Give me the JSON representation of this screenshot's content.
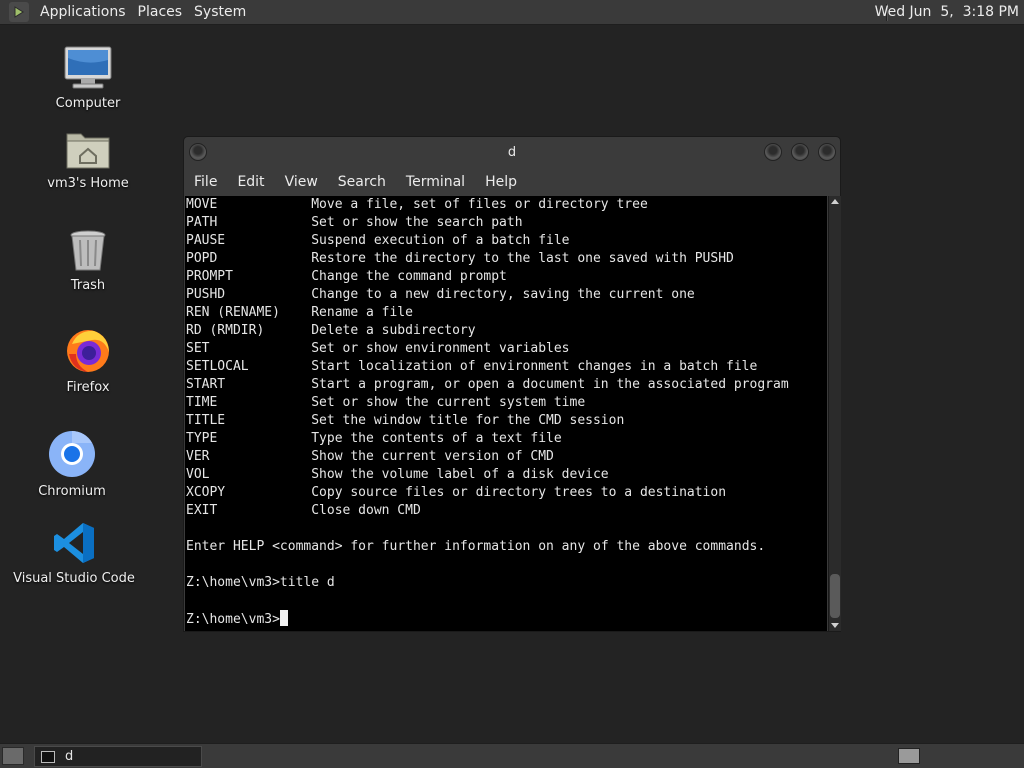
{
  "top_panel": {
    "menus": [
      "Applications",
      "Places",
      "System"
    ],
    "clock": "Wed Jun  5,  3:18 PM"
  },
  "desktop_icons": [
    {
      "label": "Computer",
      "icon": "computer-icon"
    },
    {
      "label": "vm3's Home",
      "icon": "home-folder-icon"
    },
    {
      "label": "Trash",
      "icon": "trash-icon"
    },
    {
      "label": "Firefox",
      "icon": "firefox-icon"
    },
    {
      "label": "Chromium",
      "icon": "chromium-icon"
    },
    {
      "label": "Visual Studio Code",
      "icon": "vscode-icon"
    }
  ],
  "terminal": {
    "title": "d",
    "menus": [
      "File",
      "Edit",
      "View",
      "Search",
      "Terminal",
      "Help"
    ],
    "commands": [
      {
        "cmd": "MOVE",
        "desc": "Move a file, set of files or directory tree"
      },
      {
        "cmd": "PATH",
        "desc": "Set or show the search path"
      },
      {
        "cmd": "PAUSE",
        "desc": "Suspend execution of a batch file"
      },
      {
        "cmd": "POPD",
        "desc": "Restore the directory to the last one saved with PUSHD"
      },
      {
        "cmd": "PROMPT",
        "desc": "Change the command prompt"
      },
      {
        "cmd": "PUSHD",
        "desc": "Change to a new directory, saving the current one"
      },
      {
        "cmd": "REN (RENAME)",
        "desc": "Rename a file"
      },
      {
        "cmd": "RD (RMDIR)",
        "desc": "Delete a subdirectory"
      },
      {
        "cmd": "SET",
        "desc": "Set or show environment variables"
      },
      {
        "cmd": "SETLOCAL",
        "desc": "Start localization of environment changes in a batch file"
      },
      {
        "cmd": "START",
        "desc": "Start a program, or open a document in the associated program"
      },
      {
        "cmd": "TIME",
        "desc": "Set or show the current system time"
      },
      {
        "cmd": "TITLE",
        "desc": "Set the window title for the CMD session"
      },
      {
        "cmd": "TYPE",
        "desc": "Type the contents of a text file"
      },
      {
        "cmd": "VER",
        "desc": "Show the current version of CMD"
      },
      {
        "cmd": "VOL",
        "desc": "Show the volume label of a disk device"
      },
      {
        "cmd": "XCOPY",
        "desc": "Copy source files or directory trees to a destination"
      },
      {
        "cmd": "EXIT",
        "desc": "Close down CMD"
      }
    ],
    "help_hint": "Enter HELP <command> for further information on any of the above commands.",
    "history_line": "Z:\\home\\vm3>title d",
    "prompt": "Z:\\home\\vm3>"
  },
  "taskbar": {
    "task_label": "d"
  },
  "colors": {
    "desktop_bg": "#232323",
    "panel_bg": "#3a3a3a",
    "terminal_bg": "#000000",
    "terminal_fg": "#e6e6e6"
  }
}
